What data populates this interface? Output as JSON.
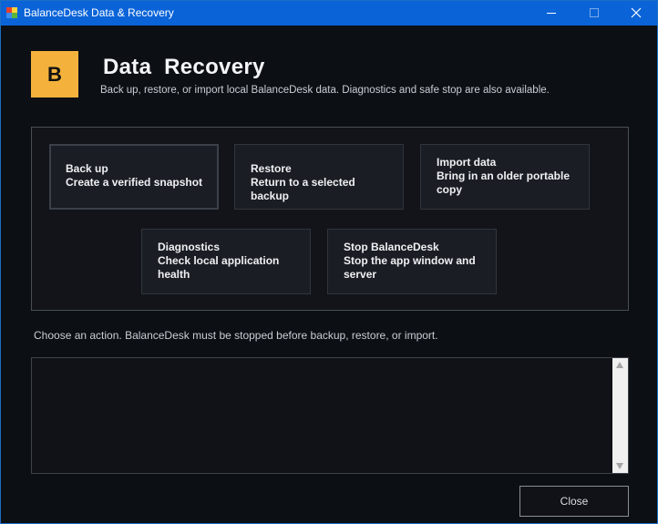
{
  "window": {
    "title": "BalanceDesk Data & Recovery",
    "icon": "app-window-icon"
  },
  "titlebar": {
    "minimize_icon": "minimize-icon",
    "maximize_icon": "maximize-icon",
    "close_icon": "close-icon"
  },
  "header": {
    "logo_letter": "B",
    "title": "Data  Recovery",
    "subtitle": "Back up, restore, or import local BalanceDesk data. Diagnostics and safe stop are also available."
  },
  "actions": [
    {
      "title": "Back up",
      "description": "Create a verified snapshot"
    },
    {
      "title": "Restore",
      "description": "Return to a selected backup"
    },
    {
      "title": "Import data",
      "description": "Bring in an older portable copy"
    },
    {
      "title": "Diagnostics",
      "description": "Check local application health"
    },
    {
      "title": "Stop BalanceDesk",
      "description": "Stop the app window and server"
    }
  ],
  "status": {
    "message": "Choose an action. BalanceDesk must be stopped before backup, restore, or import."
  },
  "log": {
    "content": ""
  },
  "footer": {
    "close_label": "Close"
  },
  "colors": {
    "titlebar": "#0a64d8",
    "background": "#0c0f14",
    "logo": "#f4b23c"
  }
}
